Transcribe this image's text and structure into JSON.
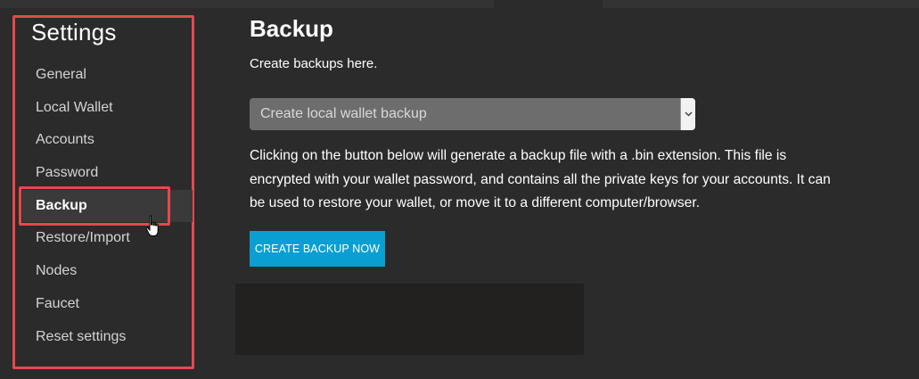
{
  "sidebar": {
    "title": "Settings",
    "items": [
      {
        "label": "General"
      },
      {
        "label": "Local Wallet"
      },
      {
        "label": "Accounts"
      },
      {
        "label": "Password"
      },
      {
        "label": "Backup",
        "active": true
      },
      {
        "label": "Restore/Import"
      },
      {
        "label": "Nodes"
      },
      {
        "label": "Faucet"
      },
      {
        "label": "Reset settings"
      }
    ]
  },
  "main": {
    "title": "Backup",
    "subtitle": "Create backups here.",
    "backup_type_select": {
      "selected": "Create local wallet backup",
      "arrow_icon": "chevron-down-icon"
    },
    "description": "Clicking on the button below will generate a backup file with a .bin extension. This file is encrypted with your wallet password, and contains all the private keys for your accounts. It can be used to restore your wallet, or move it to a different computer/browser.",
    "create_button_label": "CREATE BACKUP NOW"
  },
  "colors": {
    "background": "#2b2b2b",
    "highlight_border": "#e5484d",
    "button": "#0a9fd2",
    "select_bg": "#6d6d6d"
  },
  "cursor_icon": "hand-pointer-icon"
}
